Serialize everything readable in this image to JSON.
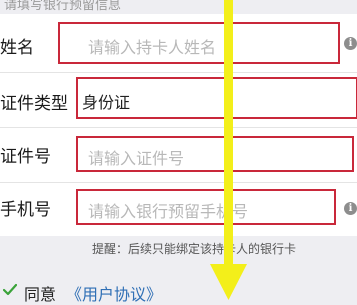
{
  "section_hint": "请填写银行预留信息",
  "form": {
    "name": {
      "label": "姓名",
      "placeholder": "请输入持卡人姓名",
      "info_icon": "info-icon"
    },
    "id_type": {
      "label": "证件类型",
      "value": "身份证"
    },
    "id_number": {
      "label": "证件号",
      "placeholder": "请输入证件号"
    },
    "phone": {
      "label": "手机号",
      "placeholder": "请输入银行预留手机号",
      "info_icon": "info-icon"
    }
  },
  "tip": "提醒：后续只能绑定该持卡人的银行卡",
  "agreement": {
    "text": "同意",
    "link": "《用户协议》",
    "checked": true
  },
  "colors": {
    "highlight_box": "#c9283a",
    "arrow": "#f3ef1a",
    "link": "#2f6fb5",
    "check": "#3aa33a"
  }
}
